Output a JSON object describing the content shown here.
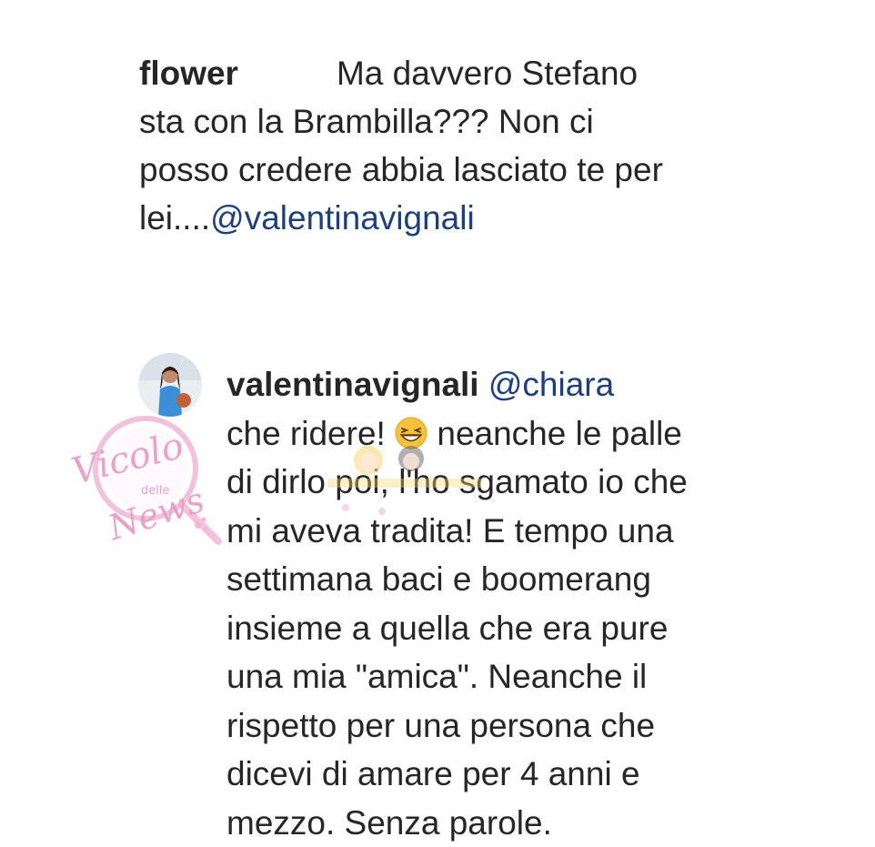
{
  "comment": {
    "username": "flower",
    "text_line1": "Ma davvero Stefano",
    "text_line2": "sta con la Brambilla??? Non ci",
    "text_line3": "posso credere abbia lasciato te per",
    "text_line4_prefix": "lei....",
    "mention": "@valentinavignali"
  },
  "reply": {
    "username": "valentinavignali",
    "mention": "@chiara",
    "lines": [
      "che ridere!",
      "neanche le palle",
      "di dirlo poi, l'ho sgamato io che",
      "mi aveva tradita! E tempo una",
      "settimana baci e boomerang",
      "insieme a quella che era pure",
      "una mia \"amica\". Neanche il",
      "rispetto per una persona che",
      "dicevi di amare per 4 anni e",
      "mezzo. Senza parole."
    ],
    "emoji_icon": "grinning-squinting-face-icon"
  },
  "watermark": {
    "text_main": "Vicolo",
    "text_small": "delle",
    "text_bottom": "News",
    "color": "#e8a0c8"
  },
  "colors": {
    "text": "#262626",
    "mention": "#1f3f7a",
    "background": "#ffffff"
  }
}
